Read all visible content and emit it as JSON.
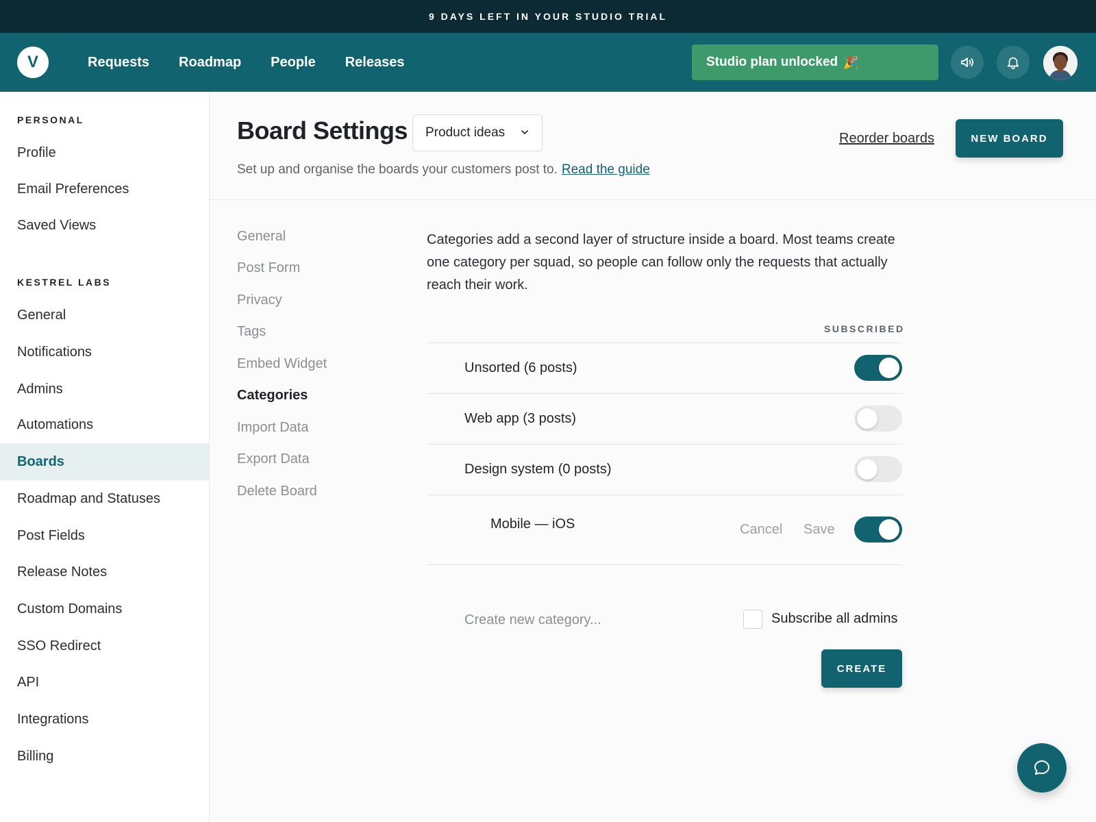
{
  "trial_banner": "9 DAYS LEFT IN YOUR STUDIO TRIAL",
  "topnav": {
    "logo": "V",
    "links": [
      "Requests",
      "Roadmap",
      "People",
      "Releases"
    ],
    "plan_button": "Studio plan unlocked",
    "plan_emoji": "🎉",
    "icons": [
      "megaphone-icon",
      "bell-icon",
      "avatar"
    ]
  },
  "sidebar": {
    "personal_heading": "PERSONAL",
    "personal_items": [
      "Profile",
      "Email Preferences",
      "Saved Views"
    ],
    "org_heading": "KESTREL LABS",
    "org_items": [
      "General",
      "Notifications",
      "Admins",
      "Automations",
      "Boards",
      "Roadmap and Statuses",
      "Post Fields",
      "Release Notes",
      "Custom Domains",
      "SSO Redirect",
      "API",
      "Integrations",
      "Billing"
    ],
    "active_item": "Boards"
  },
  "header": {
    "title": "Board Settings",
    "board_select": "Product ideas",
    "subtitle": "Set up and organise the boards your customers post to.",
    "guide_link": "Read the guide",
    "reorder_link": "Reorder boards",
    "new_board_button": "NEW BOARD"
  },
  "sub_nav": {
    "items": [
      "General",
      "Post Form",
      "Privacy",
      "Tags",
      "Embed Widget",
      "Categories",
      "Import Data",
      "Export Data",
      "Delete Board"
    ],
    "active": "Categories"
  },
  "categories": {
    "description": "Categories add a second layer of structure inside a board. Most teams create one category per squad, so people can follow only the requests that actually reach their work.",
    "subscribed_label": "SUBSCRIBED",
    "rows": [
      {
        "name": "Unsorted (6 posts)",
        "subscribed": true
      },
      {
        "name": "Web app (3 posts)",
        "subscribed": false
      },
      {
        "name": "Design system (0 posts)",
        "subscribed": false
      }
    ],
    "editing": {
      "value": "Mobile — iOS",
      "cancel": "Cancel",
      "save": "Save",
      "subscribed": true
    },
    "new_placeholder": "Create new category...",
    "subscribe_all_label": "Subscribe all admins",
    "subscribe_all_checked": false,
    "create_button": "CREATE"
  },
  "colors": {
    "primary": "#126370",
    "banner": "#0b2a33",
    "plan_green": "#3f9a6b"
  }
}
